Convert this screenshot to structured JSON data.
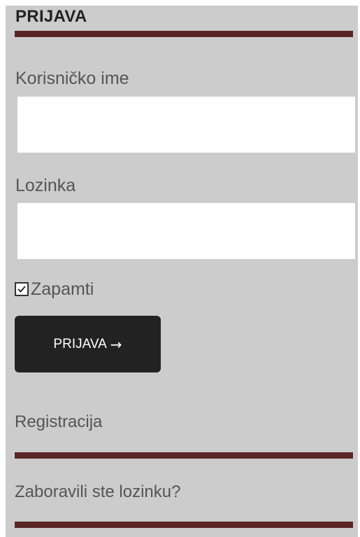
{
  "login": {
    "title": "PRIJAVA",
    "username_label": "Korisničko ime",
    "username_value": "",
    "password_label": "Lozinka",
    "password_value": "",
    "remember_label": "Zapamti",
    "remember_checked": true,
    "submit_label": "PRIJAVA",
    "submit_arrow": "→",
    "register_link": "Registracija",
    "forgot_link": "Zaboravili ste lozinku?"
  },
  "colors": {
    "panel_background": "#cccccc",
    "accent_bar": "#5a2526",
    "button_background": "#222222",
    "label_text": "#555555"
  },
  "icons": {
    "checkbox": "checkmark-icon",
    "submit": "arrow-right-icon"
  }
}
